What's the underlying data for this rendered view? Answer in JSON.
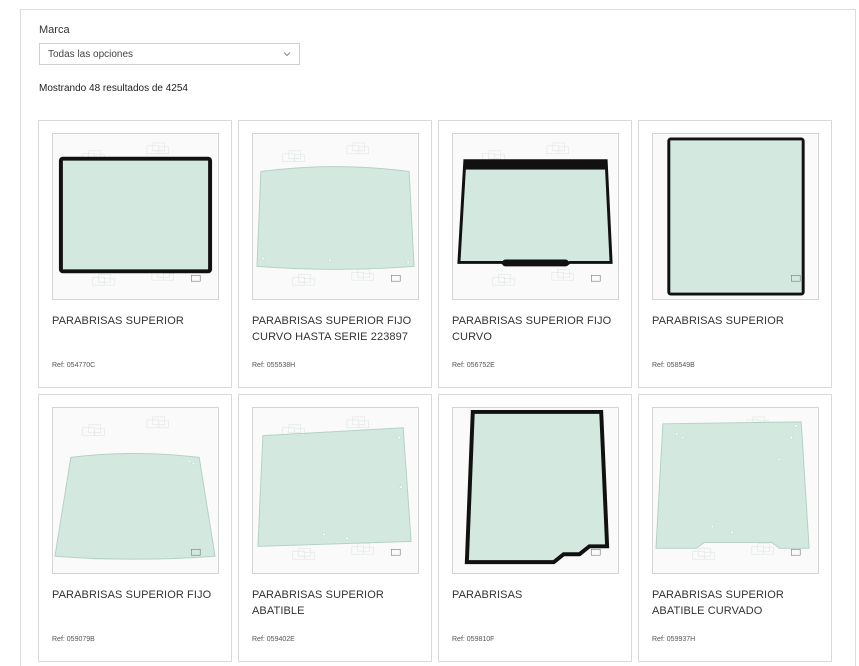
{
  "filter": {
    "label": "Marca",
    "selected": "Todas las opciones",
    "icon": "chevron-down-icon"
  },
  "results_text": "Mostrando 48 resultados de 4254",
  "products": [
    {
      "title": "PARABRISAS SUPERIOR",
      "ref": "Ref: 054770C",
      "shape": "frame-rect"
    },
    {
      "title": "PARABRISAS SUPERIOR FIJO CURVO HASTA SERIE 223897",
      "ref": "Ref: 055538H",
      "shape": "wide-curved"
    },
    {
      "title": "PARABRISAS SUPERIOR FIJO CURVO",
      "ref": "Ref: 056752E",
      "shape": "curved-dark-top"
    },
    {
      "title": "PARABRISAS SUPERIOR",
      "ref": "Ref: 058549B",
      "shape": "frame-square"
    },
    {
      "title": "PARABRISAS SUPERIOR FIJO",
      "ref": "Ref: 059079B",
      "shape": "trapezoid"
    },
    {
      "title": "PARABRISAS SUPERIOR ABATIBLE",
      "ref": "Ref: 059402E",
      "shape": "plain-rect"
    },
    {
      "title": "PARABRISAS",
      "ref": "Ref: 059810F",
      "shape": "frame-notch"
    },
    {
      "title": "PARABRISAS SUPERIOR ABATIBLE CURVADO",
      "ref": "Ref: 059937H",
      "shape": "notch-bottom"
    }
  ],
  "colors": {
    "glass": "#d3e9e0",
    "glass_edge": "#b5d1c6",
    "frame": "#111111",
    "border": "#d9d9d9"
  }
}
